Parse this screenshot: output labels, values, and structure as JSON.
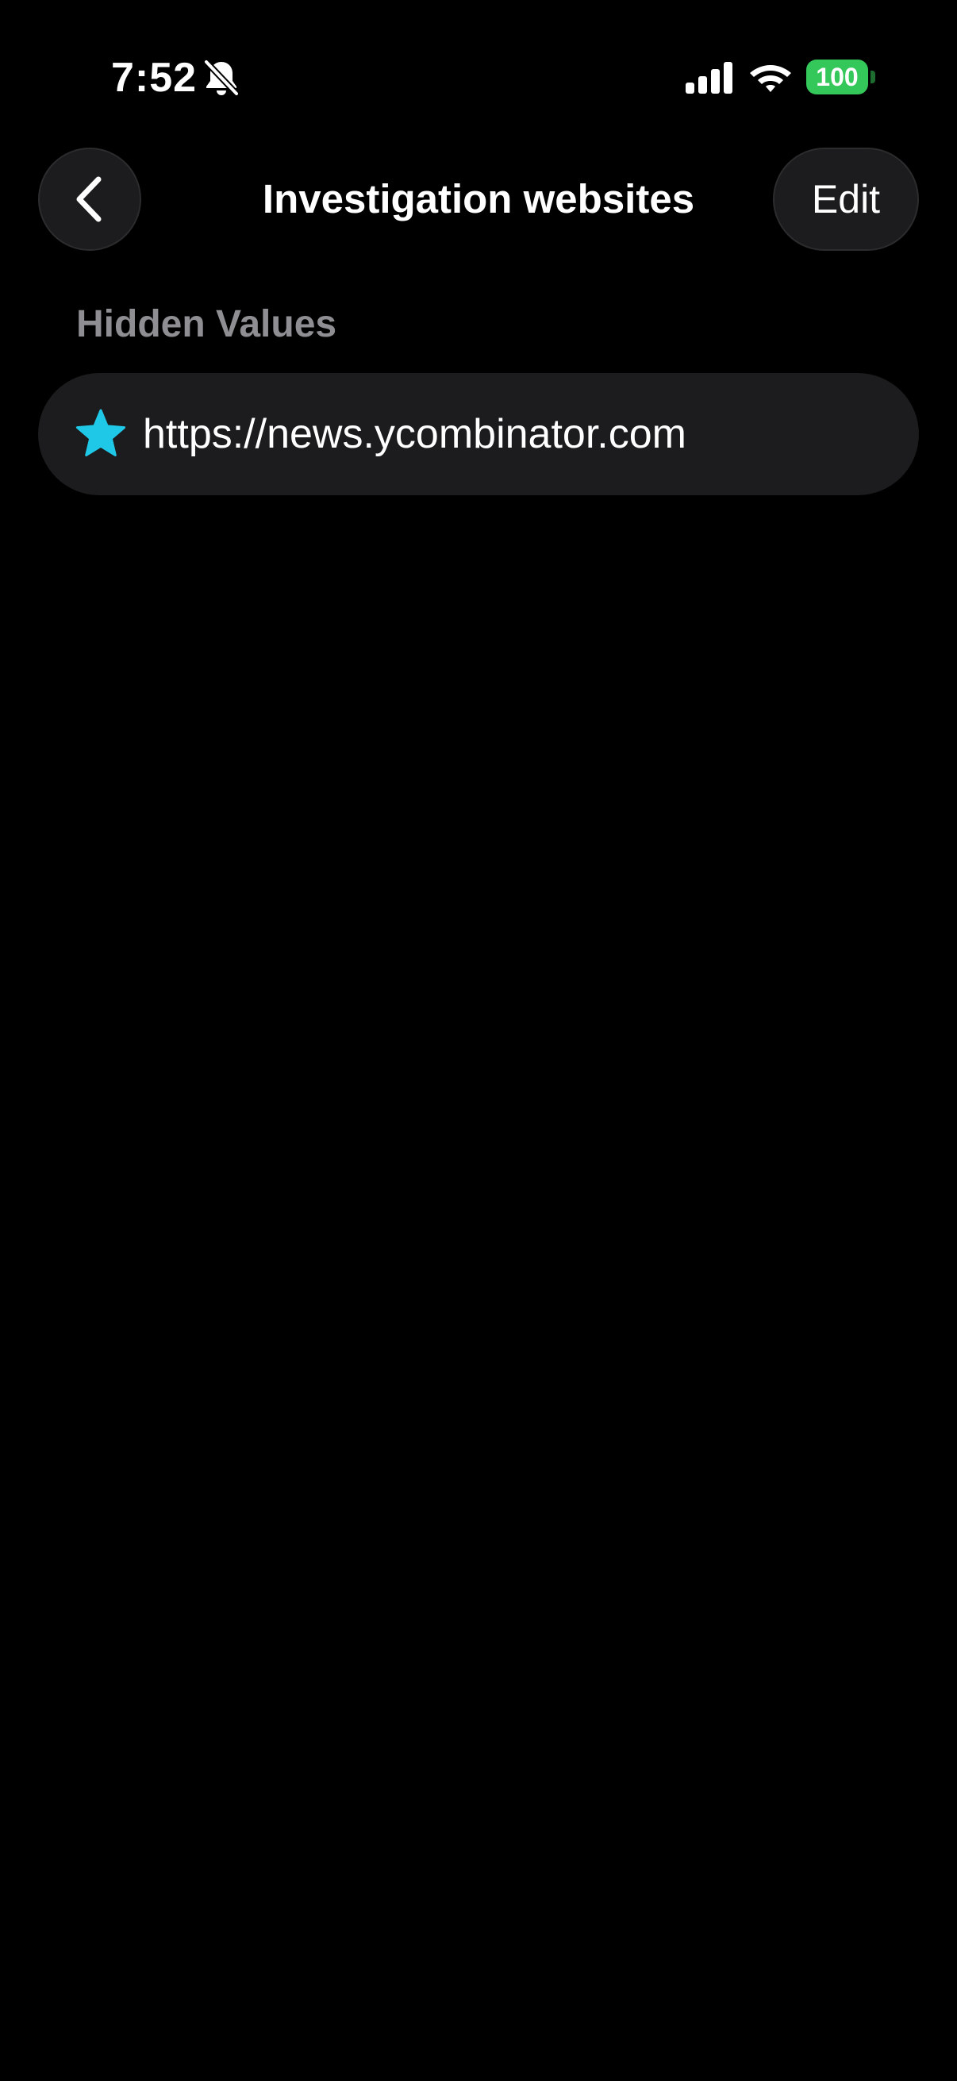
{
  "status_bar": {
    "time": "7:52",
    "mute_icon": "bell-slash-icon",
    "signal_icon": "cellular-signal-icon",
    "wifi_icon": "wifi-icon",
    "battery_level": "100",
    "battery_color": "#34c759"
  },
  "nav": {
    "back_icon": "chevron-left-icon",
    "title": "Investigation websites",
    "edit_label": "Edit"
  },
  "section": {
    "header": "Hidden Values",
    "items": [
      {
        "icon": "star-icon",
        "icon_color": "#1ec8e6",
        "label": "https://news.ycombinator.com"
      }
    ]
  },
  "colors": {
    "background": "#000000",
    "surface": "#1c1c1e",
    "secondary_text": "#8e8e93",
    "accent": "#1ec8e6"
  }
}
